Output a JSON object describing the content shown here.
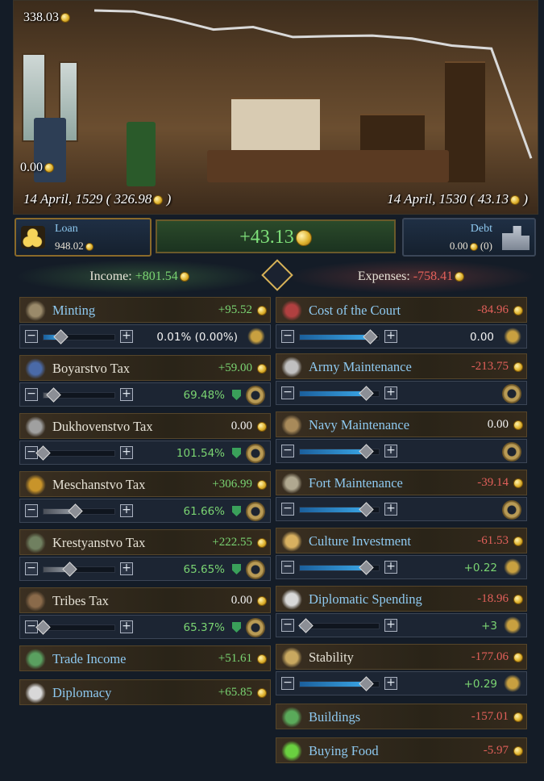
{
  "graph": {
    "max_label": "338.03",
    "min_label": "0.00",
    "start_date": "14 April, 1529 ( 326.98",
    "end_date": "14 April, 1530 ( 43.13",
    "paren_close": ")",
    "line_values": [
      338.03,
      336,
      320,
      300,
      305,
      285,
      287,
      288,
      282,
      268,
      262,
      43.13
    ]
  },
  "topbar": {
    "loan_label": "Loan",
    "loan_value": "948.02",
    "balance": "+43.13",
    "debt_label": "Debt",
    "debt_value": "0.00",
    "debt_count": "(0)"
  },
  "income": {
    "label": "Income:",
    "value": "+801.54"
  },
  "expenses": {
    "label": "Expenses:",
    "value": "-758.41"
  },
  "income_items": [
    {
      "label": "Minting",
      "value": "+95.52",
      "ctrl_text": "0.01% (0.00%)",
      "icon": "hammer-icon",
      "slider": 0.25
    },
    {
      "label": "Boyarstvo Tax",
      "value": "+59.00",
      "ctrl_text": "69.48%",
      "icon": "castle-icon",
      "slider": 0.15
    },
    {
      "label": "Dukhovenstvo Tax",
      "value": "0.00",
      "ctrl_text": "101.54%",
      "icon": "church-icon",
      "slider": 0.0
    },
    {
      "label": "Meschanstvo Tax",
      "value": "+306.99",
      "ctrl_text": "61.66%",
      "icon": "pyramid-icon",
      "slider": 0.45
    },
    {
      "label": "Krestyanstvo Tax",
      "value": "+222.55",
      "ctrl_text": "65.65%",
      "icon": "farmer-icon",
      "slider": 0.37
    },
    {
      "label": "Tribes Tax",
      "value": "0.00",
      "ctrl_text": "65.37%",
      "icon": "tribe-icon",
      "slider": 0.0
    },
    {
      "label": "Trade Income",
      "value": "+51.61",
      "icon": "globe-icon"
    },
    {
      "label": "Diplomacy",
      "value": "+65.85",
      "icon": "dove-icon"
    }
  ],
  "expense_items": [
    {
      "label": "Cost of the Court",
      "value": "-84.96",
      "ctrl_text": "0.00",
      "icon": "throne-icon",
      "slider": 0.9
    },
    {
      "label": "Army Maintenance",
      "value": "-213.75",
      "icon": "soldier-icon",
      "slider": 0.85
    },
    {
      "label": "Navy Maintenance",
      "value": "0.00",
      "icon": "wheel-icon",
      "slider": 0.85
    },
    {
      "label": "Fort Maintenance",
      "value": "-39.14",
      "icon": "fort-icon",
      "slider": 0.85
    },
    {
      "label": "Culture Investment",
      "value": "-61.53",
      "ctrl_text": "+0.22",
      "icon": "masks-icon",
      "slider": 0.85
    },
    {
      "label": "Diplomatic Spending",
      "value": "-18.96",
      "ctrl_text": "+3",
      "icon": "dove-icon",
      "slider": 0.08
    },
    {
      "label": "Stability",
      "value": "-177.06",
      "ctrl_text": "+0.29",
      "icon": "scales-icon",
      "slider": 0.85
    },
    {
      "label": "Buildings",
      "value": "-157.01",
      "icon": "chart-icon"
    },
    {
      "label": "Buying Food",
      "value": "-5.97",
      "icon": "apple-icon"
    }
  ]
}
